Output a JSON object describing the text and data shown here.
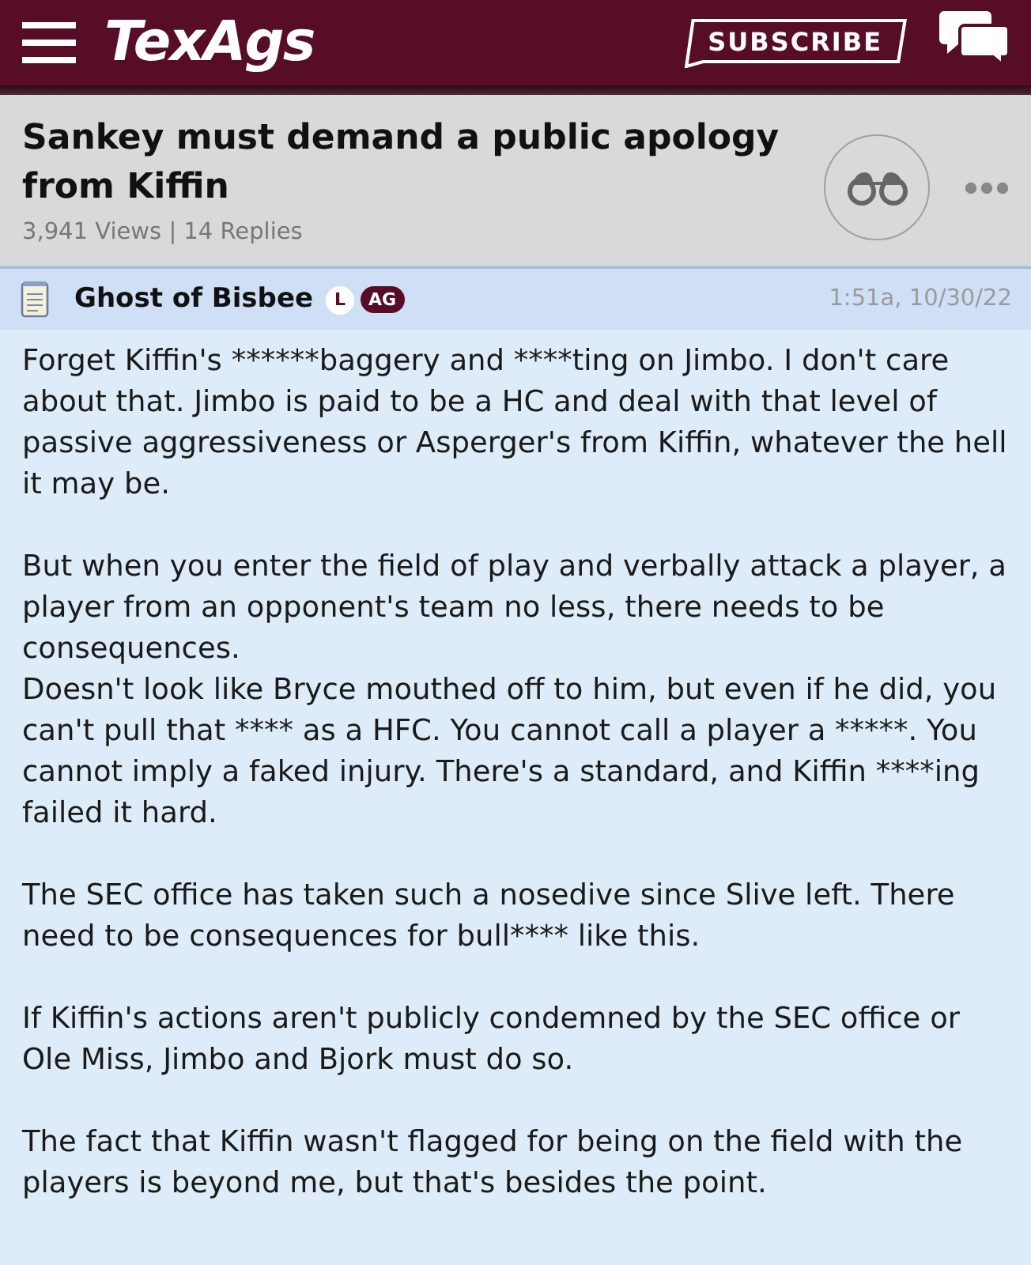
{
  "header": {
    "logo": "TexAgs",
    "subscribe_button": "SUBSCRIBE"
  },
  "thread": {
    "title": "Sankey must demand a public apology from Kiffin",
    "stats": "3,941 Views | 14 Replies"
  },
  "post": {
    "author": "Ghost of Bisbee",
    "badges": [
      {
        "label": "L",
        "kind": "circle"
      },
      {
        "label": "AG",
        "kind": "pill"
      }
    ],
    "time": "1:51a, 10/30/22",
    "paragraphs": [
      "Forget Kiffin's ******baggery and ****ting on Jimbo. I don't care about that. Jimbo is paid to be a HC and deal with that level of passive aggressiveness or Asperger's from Kiffin, whatever the hell it may be.",
      "But when you enter the field of play and verbally attack a player, a player from an opponent's team no less, there needs to be consequences.\nDoesn't look like Bryce mouthed off to him, but even if he did, you can't pull that **** as a HFC. You cannot call a player a *****. You cannot imply a faked injury. There's a standard, and Kiffin ****ing failed it hard.",
      "The SEC office has taken such a nosedive since Slive left. There need to be consequences for bull**** like this.",
      "If Kiffin's actions aren't publicly condemned by the SEC office or Ole Miss, Jimbo and Bjork must do so.",
      "The fact that Kiffin wasn't flagged for being on the field with the players is beyond me, but that's besides the point."
    ]
  }
}
